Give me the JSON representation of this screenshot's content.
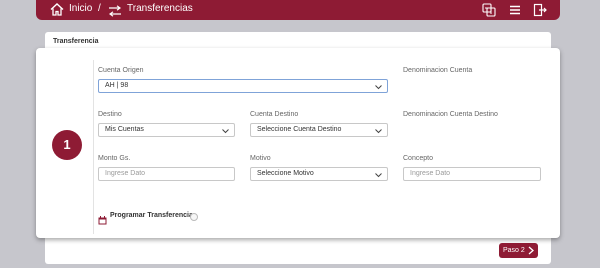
{
  "header": {
    "home_label": "Inicio",
    "separator": "/",
    "current_label": "Transferencias"
  },
  "panel": {
    "title": "Transferencia"
  },
  "step": {
    "number": "1"
  },
  "form": {
    "cuenta_origen": {
      "label": "Cuenta Origen",
      "value": "AH | 98"
    },
    "denominacion_cuenta": {
      "label": "Denominacion Cuenta"
    },
    "destino": {
      "label": "Destino",
      "value": "Mis Cuentas"
    },
    "cuenta_destino": {
      "label": "Cuenta Destino",
      "value": "Seleccione Cuenta Destino"
    },
    "denominacion_cuenta_destino": {
      "label": "Denominacion Cuenta Destino"
    },
    "monto": {
      "label": "Monto Gs.",
      "placeholder": "Ingrese Dato"
    },
    "motivo": {
      "label": "Motivo",
      "value": "Seleccione Motivo"
    },
    "concepto": {
      "label": "Concepto",
      "placeholder": "Ingrese Dato"
    },
    "programar": {
      "label": "Programar Transferencia",
      "checked": false
    }
  },
  "next_button": {
    "label": "Paso 2"
  },
  "colors": {
    "brand": "#8e1b34",
    "background": "#c6c6cc",
    "focus_border": "#7fa3d8"
  },
  "icons": [
    "home-icon",
    "transfer-icon",
    "exchange-icon",
    "menu-icon",
    "logout-icon",
    "chevron-down-icon",
    "calendar-icon",
    "chevron-right-icon"
  ]
}
